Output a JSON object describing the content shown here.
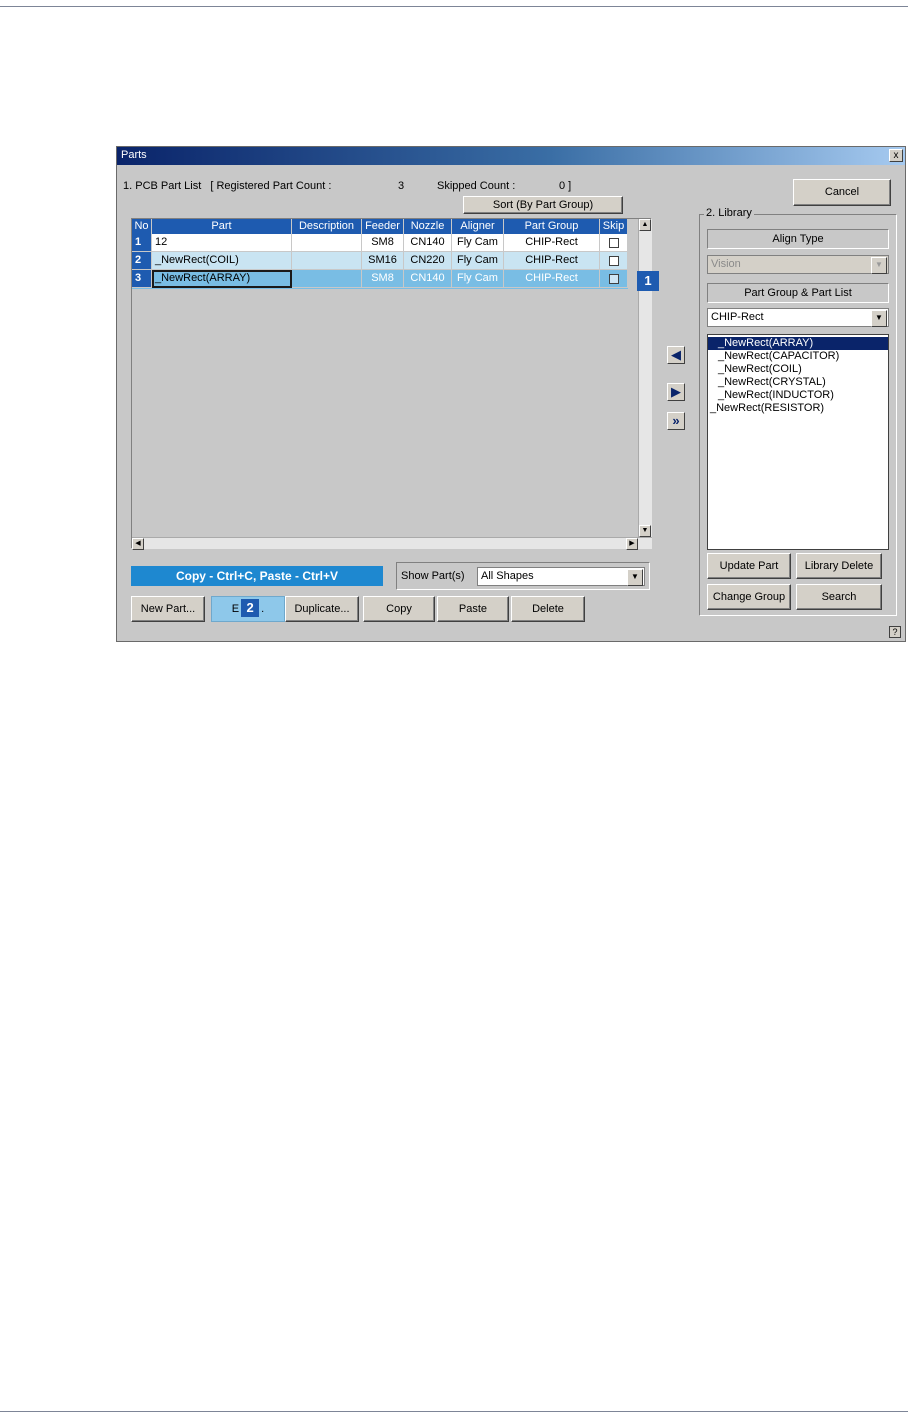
{
  "window": {
    "title": "Parts",
    "close_glyph": "x",
    "help_glyph": "?"
  },
  "part_list": {
    "label_prefix": "1. PCB Part List",
    "registered_label": "[ Registered Part Count :",
    "registered_count": "3",
    "skipped_label": "Skipped Count :",
    "skipped_count": "0 ]",
    "sort_button": "Sort (By Part Group)",
    "columns": [
      "No",
      "Part",
      "Description",
      "Feeder",
      "Nozzle",
      "Aligner",
      "Part Group",
      "Skip"
    ],
    "rows": [
      {
        "no": "1",
        "part": "12",
        "description": "",
        "feeder": "SM8",
        "nozzle": "CN140",
        "aligner": "Fly Cam",
        "group": "CHIP-Rect",
        "skip": false
      },
      {
        "no": "2",
        "part": "_NewRect(COIL)",
        "description": "",
        "feeder": "SM16",
        "nozzle": "CN220",
        "aligner": "Fly Cam",
        "group": "CHIP-Rect",
        "skip": false
      },
      {
        "no": "3",
        "part": "_NewRect(ARRAY)",
        "description": "",
        "feeder": "SM8",
        "nozzle": "CN140",
        "aligner": "Fly Cam",
        "group": "CHIP-Rect",
        "skip": false
      }
    ]
  },
  "callouts": {
    "one": "1",
    "two": "2"
  },
  "hint": "Copy - Ctrl+C, Paste - Ctrl+V",
  "show_parts": {
    "label": "Show Part(s)",
    "value": "All Shapes"
  },
  "buttons": {
    "new_part": "New Part...",
    "edit": "E",
    "edit_tail": ".",
    "duplicate": "Duplicate...",
    "copy": "Copy",
    "paste": "Paste",
    "delete": "Delete",
    "cancel": "Cancel"
  },
  "library": {
    "label": "2. Library",
    "align_type_label": "Align Type",
    "align_type_value": "Vision",
    "group_list_label": "Part Group & Part List",
    "group_value": "CHIP-Rect",
    "items": [
      "_NewRect(ARRAY)",
      "_NewRect(CAPACITOR)",
      "_NewRect(COIL)",
      "_NewRect(CRYSTAL)",
      "_NewRect(INDUCTOR)",
      "_NewRect(RESISTOR)"
    ],
    "selected_index": 0,
    "update_part": "Update Part",
    "library_delete": "Library Delete",
    "change_group": "Change Group",
    "search": "Search"
  },
  "icons": [
    "arrow-left-icon",
    "arrow-right-icon",
    "double-arrow-right-icon",
    "checkbox-icon",
    "dropdown-arrow-icon",
    "help-icon",
    "close-icon"
  ],
  "colors": {
    "accent": "#1e5bb0",
    "title_start": "#0a246a",
    "title_end": "#a6caf0",
    "window_bg": "#c8c8c8",
    "row_highlight": "#c9e4f2"
  }
}
